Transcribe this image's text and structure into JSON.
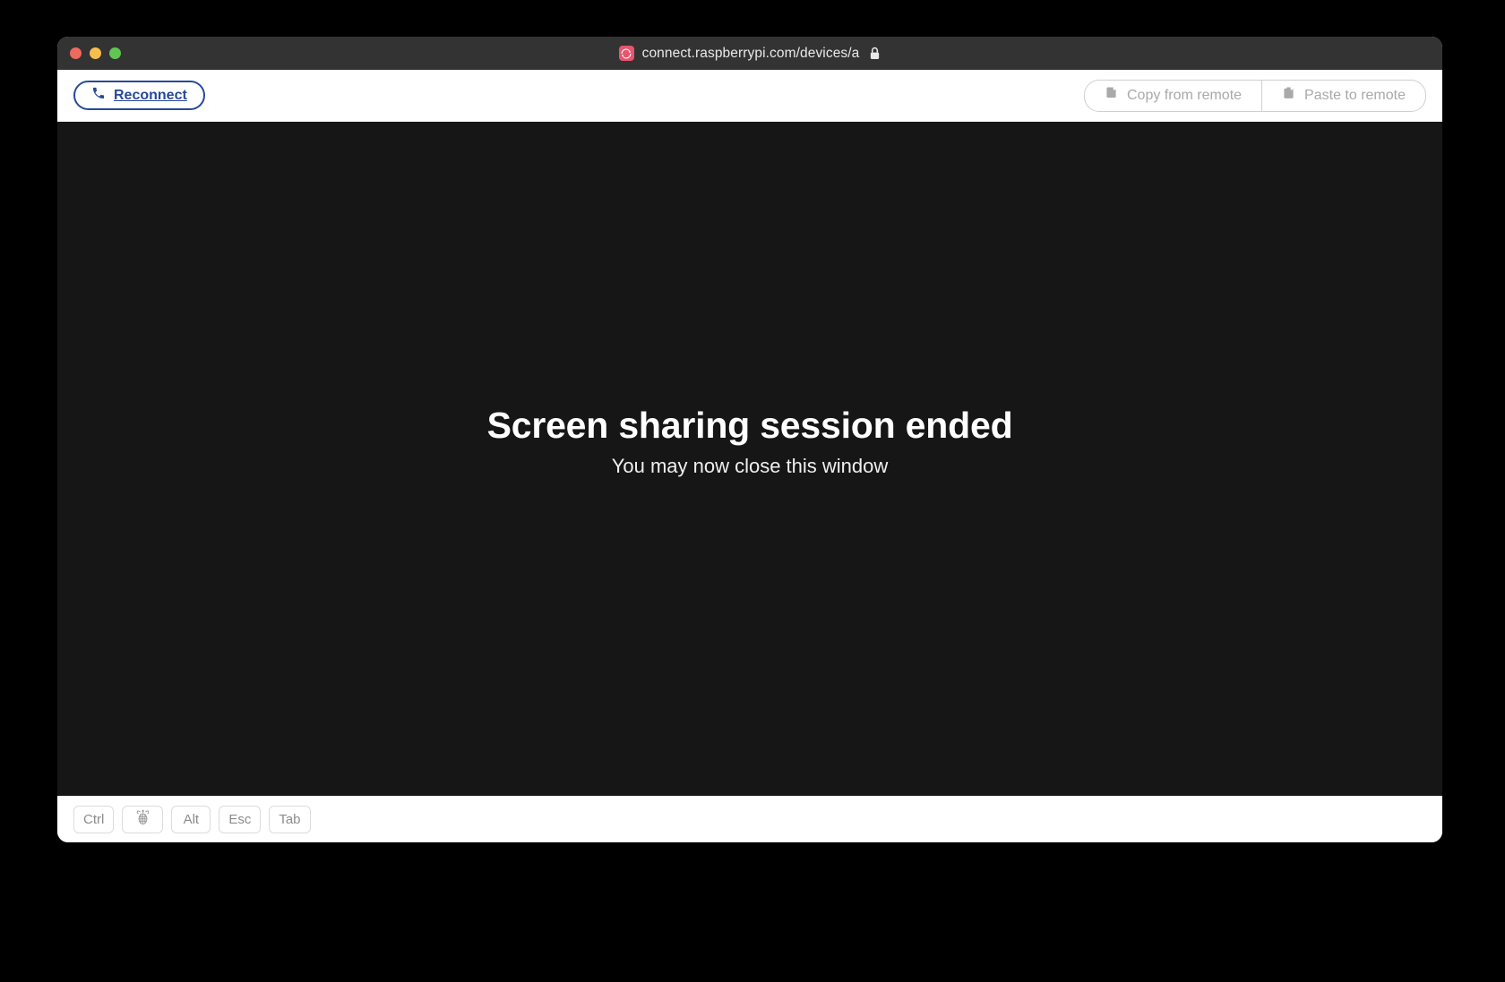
{
  "window": {
    "traffic_lights": [
      {
        "name": "close",
        "color": "#ed6a5e"
      },
      {
        "name": "minimize",
        "color": "#f4bf4f"
      },
      {
        "name": "zoom",
        "color": "#61c554"
      }
    ],
    "url": "connect.raspberrypi.com/devices/a",
    "favicon_name": "raspberry-pi-connect-favicon",
    "lock_icon_name": "lock-icon"
  },
  "toolbar": {
    "reconnect_label": "Reconnect",
    "reconnect_icon": "phone-icon",
    "reconnect_color": "#27499a",
    "copy_from_remote_label": "Copy from remote",
    "copy_icon": "clipboard-copy-icon",
    "paste_to_remote_label": "Paste to remote",
    "paste_icon": "clipboard-paste-icon",
    "clipboard_text_color": "#a9a9a9"
  },
  "main": {
    "title": "Screen sharing session ended",
    "subtitle": "You may now close this window",
    "background_color": "#161616"
  },
  "keybar": {
    "keys": [
      {
        "label": "Ctrl",
        "icon": ""
      },
      {
        "label": "",
        "icon": "raspberry-pi-icon"
      },
      {
        "label": "Alt",
        "icon": ""
      },
      {
        "label": "Esc",
        "icon": ""
      },
      {
        "label": "Tab",
        "icon": ""
      }
    ]
  }
}
